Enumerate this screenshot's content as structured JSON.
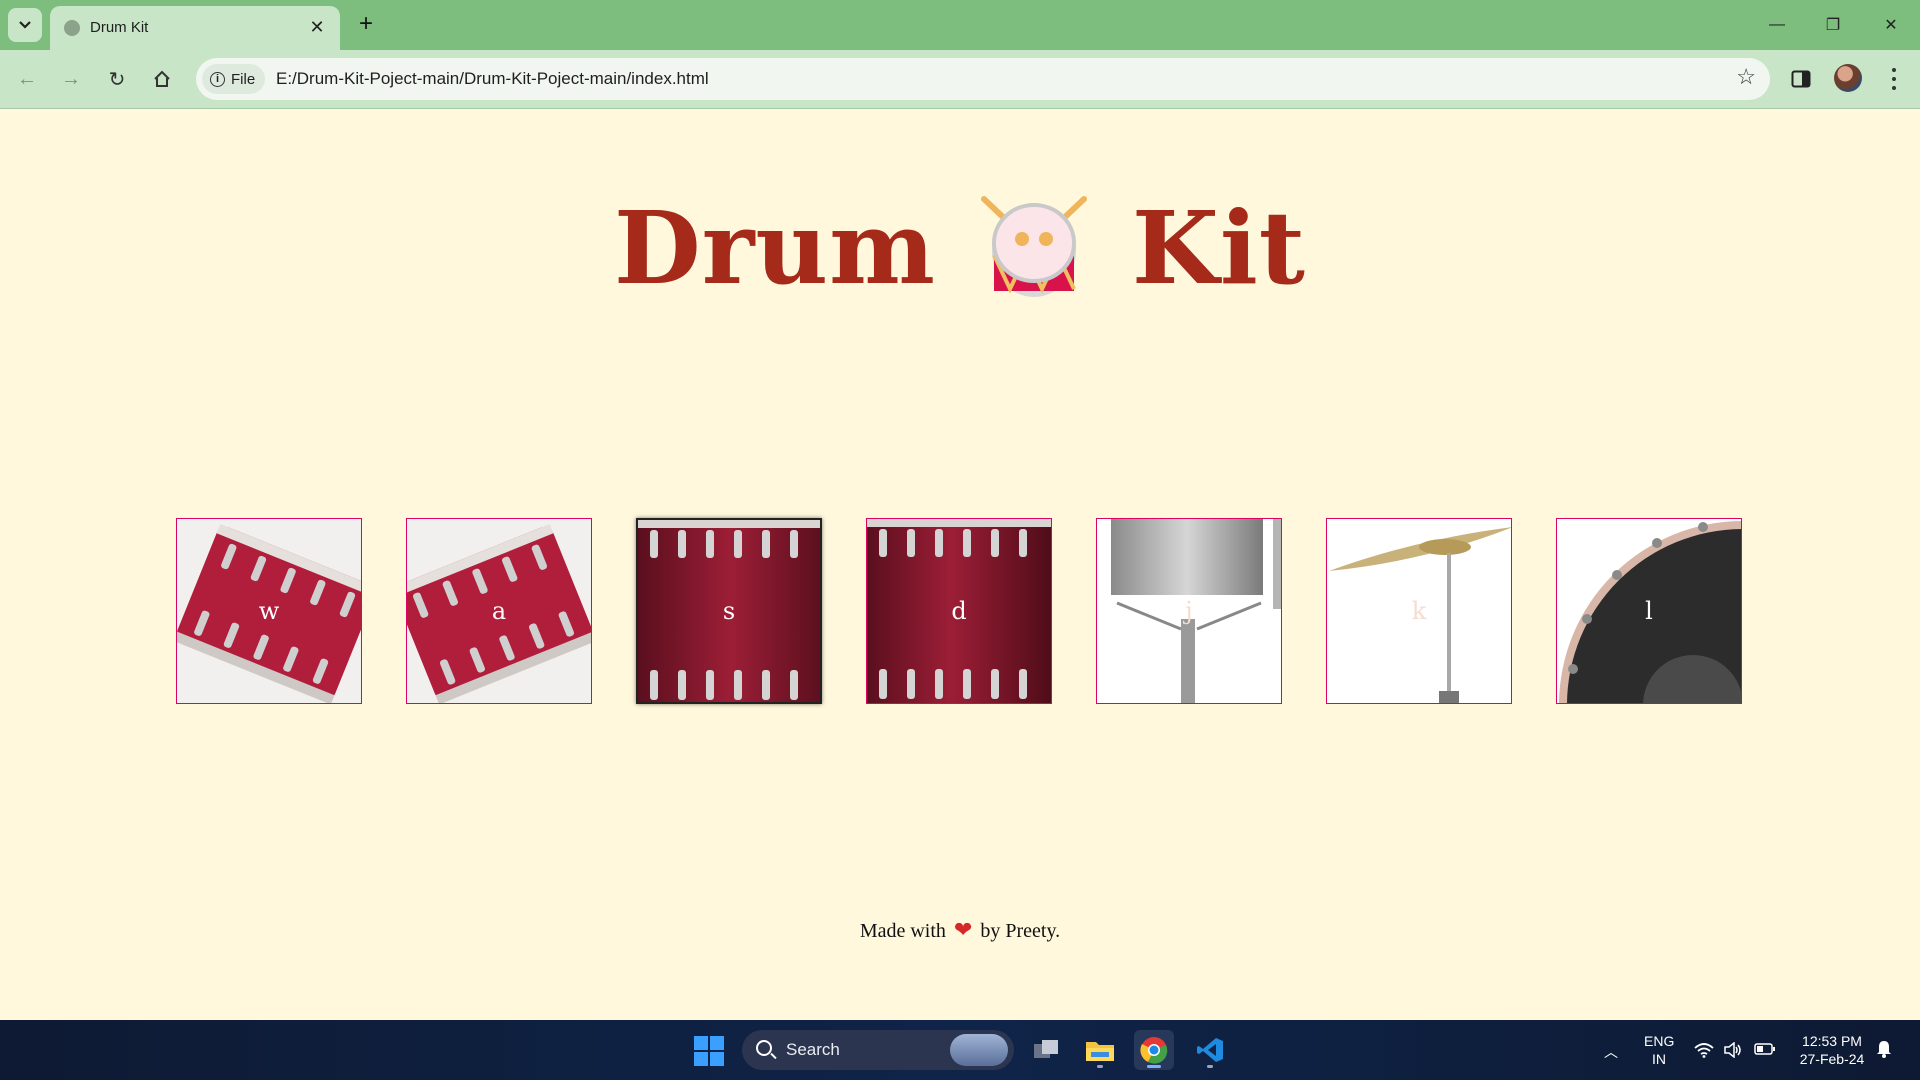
{
  "browser": {
    "tab_title": "Drum Kit",
    "chip_label": "File",
    "url": "E:/Drum-Kit-Poject-main/Drum-Kit-Poject-main/index.html"
  },
  "page": {
    "title_left": "Drum",
    "title_right": "Kit",
    "drums": [
      {
        "key": "w",
        "name": "tom-1"
      },
      {
        "key": "a",
        "name": "tom-2"
      },
      {
        "key": "s",
        "name": "tom-3",
        "pressed": true
      },
      {
        "key": "d",
        "name": "tom-4"
      },
      {
        "key": "j",
        "name": "snare"
      },
      {
        "key": "k",
        "name": "crash"
      },
      {
        "key": "l",
        "name": "kick"
      }
    ],
    "footer_before": "Made with",
    "footer_after": "by Preety."
  },
  "taskbar": {
    "search_label": "Search",
    "lang_line1": "ENG",
    "lang_line2": "IN",
    "time": "12:53 PM",
    "date": "27-Feb-24"
  },
  "colors": {
    "page_bg": "#fff8dc",
    "title": "#a52a1a",
    "drum_border": "#da0463",
    "tab_strip": "#7dbd7d"
  }
}
